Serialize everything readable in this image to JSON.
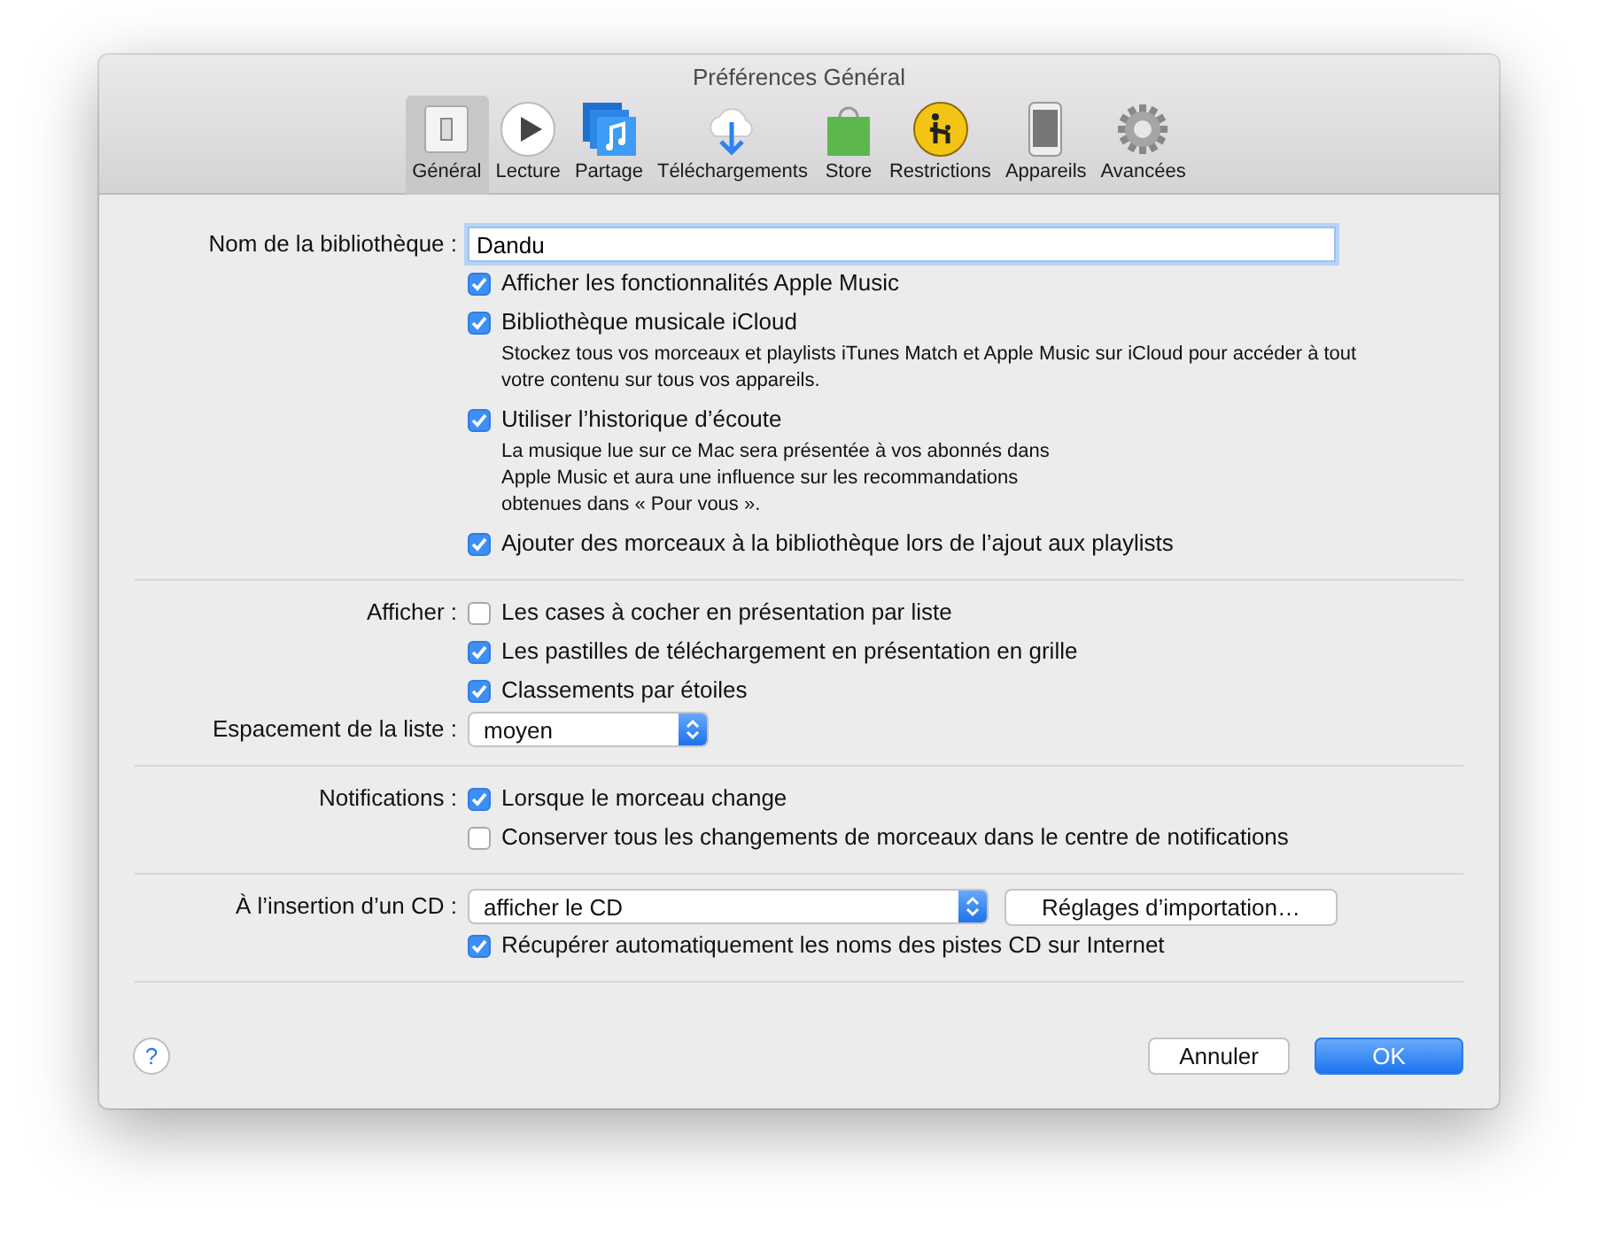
{
  "window": {
    "title": "Préférences Général"
  },
  "toolbar": [
    {
      "label": "Général",
      "selected": true
    },
    {
      "label": "Lecture",
      "selected": false
    },
    {
      "label": "Partage",
      "selected": false
    },
    {
      "label": "Téléchargements",
      "selected": false
    },
    {
      "label": "Store",
      "selected": false
    },
    {
      "label": "Restrictions",
      "selected": false
    },
    {
      "label": "Appareils",
      "selected": false
    },
    {
      "label": "Avancées",
      "selected": false
    }
  ],
  "sections": [
    {
      "rows": [
        {
          "kind": "field",
          "caption": "Nom de la bibliothèque :",
          "value": "Dandu"
        },
        {
          "kind": "checkbox",
          "text": "Afficher les fonctionnalités Apple Music",
          "checked": true
        },
        {
          "kind": "checkbox",
          "text": "Bibliothèque musicale iCloud",
          "checked": true,
          "note": [
            "Stockez tous vos morceaux et playlists iTunes Match et Apple Music sur iCloud pour accéder à tout",
            "votre contenu sur tous vos appareils."
          ]
        },
        {
          "kind": "checkbox",
          "text": "Utiliser l’historique d’écoute",
          "checked": true,
          "note": [
            "La musique lue sur ce Mac sera présentée à vos abonnés dans",
            "Apple Music et aura une influence sur les recommandations",
            "obtenues dans « Pour vous »."
          ]
        },
        {
          "kind": "checkbox",
          "text": "Ajouter des morceaux à la bibliothèque lors de l’ajout aux playlists",
          "checked": true
        }
      ]
    },
    {
      "rows": [
        {
          "kind": "checkbox",
          "caption": "Afficher :",
          "text": "Les cases à cocher en présentation par liste",
          "checked": false
        },
        {
          "kind": "checkbox",
          "text": "Les pastilles de téléchargement en présentation en grille",
          "checked": true
        },
        {
          "kind": "checkbox",
          "text": "Classements par étoiles",
          "checked": true
        },
        {
          "kind": "select",
          "caption": "Espacement de la liste :",
          "value": "moyen"
        }
      ]
    },
    {
      "rows": [
        {
          "kind": "checkbox",
          "caption": "Notifications :",
          "text": "Lorsque le morceau change",
          "checked": true
        },
        {
          "kind": "checkbox",
          "text": "Conserver tous les changements de morceaux dans le centre de notifications",
          "checked": false
        }
      ]
    },
    {
      "rows": [
        {
          "kind": "select",
          "caption": "À l’insertion d’un CD :",
          "value": "afficher le CD",
          "button": "Réglages d’importation…"
        },
        {
          "kind": "checkbox",
          "text": "Récupérer automatiquement les noms des pistes CD sur Internet",
          "checked": true
        }
      ]
    }
  ],
  "help": "?",
  "buttons": [
    {
      "label": "Annuler",
      "default": false
    },
    {
      "label": "OK",
      "default": true
    }
  ]
}
